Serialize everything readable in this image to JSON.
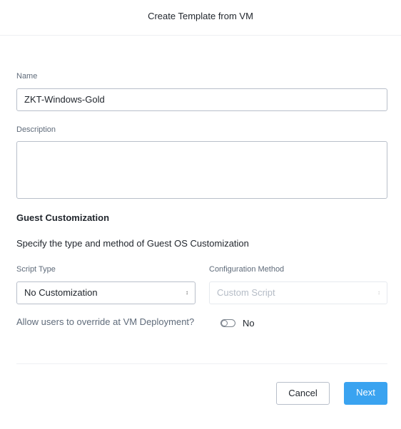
{
  "dialog": {
    "title": "Create Template from VM"
  },
  "form": {
    "name_label": "Name",
    "name_value": "ZKT-Windows-Gold",
    "description_label": "Description",
    "description_value": "",
    "section_title": "Guest Customization",
    "section_desc": "Specify the type and method of Guest OS Customization",
    "script_type_label": "Script Type",
    "script_type_value": "No Customization",
    "config_method_label": "Configuration Method",
    "config_method_value": "Custom Script",
    "override_label": "Allow users to override at VM Deployment?",
    "override_state": "No"
  },
  "footer": {
    "cancel": "Cancel",
    "next": "Next"
  },
  "colors": {
    "primary": "#3aa3f0"
  }
}
